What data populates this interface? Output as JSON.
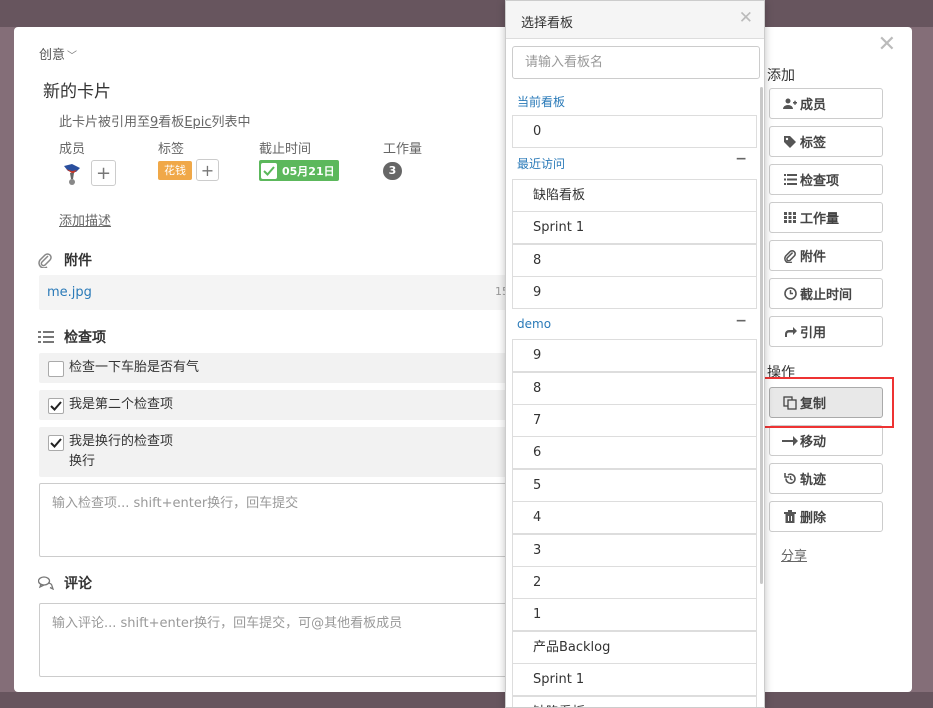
{
  "card": {
    "breadcrumb": "创意",
    "title": "新的卡片",
    "ref_prefix": "此卡片被引用至",
    "ref_count": "9",
    "ref_board_word": "看板",
    "ref_list": "Epic",
    "ref_suffix": "列表中",
    "labels": {
      "members": "成员",
      "tags": "标签",
      "due": "截止时间",
      "workload": "工作量"
    },
    "tag_value": "花钱",
    "due_value": "05月21日",
    "workload_value": "3",
    "add_description": "添加描述",
    "attachments_title": "附件",
    "attachment": {
      "name": "me.jpg",
      "size": "15"
    },
    "checklist_title": "检查项",
    "checklist": [
      {
        "text": "检查一下车胎是否有气",
        "checked": false
      },
      {
        "text": "我是第二个检查项",
        "checked": true
      },
      {
        "text": "我是换行的检查项",
        "text2": "换行",
        "checked": true
      }
    ],
    "checklist_placeholder": "输入检查项... shift+enter换行，回车提交",
    "comments_title": "评论",
    "comment_placeholder": "输入评论... shift+enter换行，回车提交，可@其他看板成员"
  },
  "sidebar": {
    "add_title": "添加",
    "add_buttons": [
      "成员",
      "标签",
      "检查项",
      "工作量",
      "附件",
      "截止时间",
      "引用"
    ],
    "actions_title": "操作",
    "action_buttons": [
      "复制",
      "移动",
      "轨迹",
      "删除"
    ],
    "share": "分享"
  },
  "dropdown": {
    "title": "选择看板",
    "search_placeholder": "请输入看板名",
    "current_label": "当前看板",
    "current": [
      "0"
    ],
    "recent_label": "最近访问",
    "recent": [
      "缺陷看板",
      "Sprint 1",
      "8",
      "9"
    ],
    "demo_label": "demo",
    "demo": [
      "9",
      "8",
      "7",
      "6",
      "5",
      "4",
      "3",
      "2",
      "1",
      "产品Backlog",
      "Sprint 1",
      "缺陷看板"
    ]
  }
}
